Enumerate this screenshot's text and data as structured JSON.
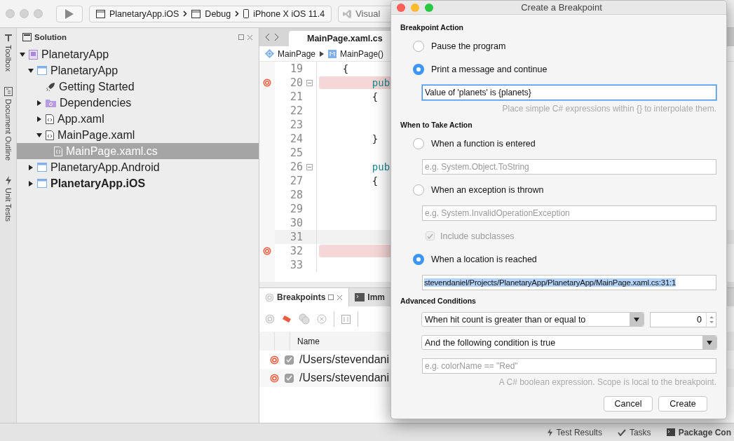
{
  "toolbar": {
    "scheme": [
      "PlanetaryApp.iOS",
      "Debug",
      "iPhone X iOS 11.4"
    ],
    "status": "Visual"
  },
  "side_tabs": [
    {
      "label": "Toolbox",
      "kind": "toolbox"
    },
    {
      "label": "Document Outline",
      "kind": "outline"
    },
    {
      "label": "Unit Tests",
      "kind": "tests"
    }
  ],
  "solution": {
    "title": "Solution",
    "tree": [
      {
        "label": "PlanetaryApp",
        "kind": "solution",
        "expanded": true,
        "selected": false,
        "startup": false,
        "children": [
          {
            "label": "PlanetaryApp",
            "kind": "project",
            "expanded": true,
            "selected": false,
            "startup": false,
            "children": [
              {
                "label": "Getting Started",
                "kind": "rocket",
                "selected": false,
                "startup": false
              },
              {
                "label": "Dependencies",
                "kind": "folder",
                "expanded": false,
                "selected": false,
                "startup": false
              },
              {
                "label": "App.xaml",
                "kind": "xaml",
                "expanded": false,
                "selected": false,
                "startup": false
              },
              {
                "label": "MainPage.xaml",
                "kind": "xaml",
                "expanded": true,
                "selected": false,
                "startup": false,
                "children": [
                  {
                    "label": "MainPage.xaml.cs",
                    "kind": "cs",
                    "selected": true,
                    "startup": false
                  }
                ]
              }
            ]
          },
          {
            "label": "PlanetaryApp.Android",
            "kind": "project",
            "expanded": false,
            "selected": false,
            "startup": false
          },
          {
            "label": "PlanetaryApp.iOS",
            "kind": "project",
            "expanded": false,
            "selected": false,
            "startup": true
          }
        ]
      }
    ]
  },
  "editor": {
    "tab": "MainPage.xaml.cs",
    "breadcrumb": [
      "MainPage",
      "MainPage()"
    ],
    "lines": [
      {
        "number": "19",
        "code": "    {",
        "kind": "punct",
        "breakpoint": false,
        "fold": false,
        "current": false
      },
      {
        "number": "20",
        "code": "         pub",
        "kind": "keyword",
        "breakpoint": true,
        "fold": true,
        "current": false
      },
      {
        "number": "21",
        "code": "         {",
        "kind": "punct",
        "breakpoint": false,
        "fold": false,
        "current": false
      },
      {
        "number": "22",
        "breakpoint": false,
        "fold": false,
        "current": false
      },
      {
        "number": "23",
        "breakpoint": false,
        "fold": false,
        "current": false
      },
      {
        "number": "24",
        "code": "         }",
        "kind": "punct",
        "breakpoint": false,
        "fold": false,
        "current": false
      },
      {
        "number": "25",
        "breakpoint": false,
        "fold": false,
        "current": false
      },
      {
        "number": "26",
        "code": "         pub",
        "kind": "keyword",
        "breakpoint": false,
        "fold": true,
        "current": false
      },
      {
        "number": "27",
        "code": "         {",
        "kind": "punct",
        "breakpoint": false,
        "fold": false,
        "current": false
      },
      {
        "number": "28",
        "breakpoint": false,
        "fold": false,
        "current": false
      },
      {
        "number": "29",
        "breakpoint": false,
        "fold": false,
        "current": false
      },
      {
        "number": "30",
        "breakpoint": false,
        "fold": false,
        "current": false
      },
      {
        "number": "31",
        "breakpoint": false,
        "fold": false,
        "current": true
      },
      {
        "number": "32",
        "breakpoint": true,
        "fold": false,
        "current": false
      },
      {
        "number": "33",
        "breakpoint": false,
        "fold": false,
        "current": false
      }
    ]
  },
  "bottom_panel": {
    "tabs": [
      {
        "label": "Breakpoints",
        "selected": true
      },
      {
        "label": "Imm",
        "selected": false
      }
    ],
    "column": "Name",
    "rows": [
      {
        "checked": true,
        "name": "/Users/stevendani"
      },
      {
        "checked": true,
        "name": "/Users/stevendani"
      }
    ]
  },
  "status_bar": [
    {
      "label": "Test Results",
      "kind": "bolt"
    },
    {
      "label": "Tasks",
      "kind": "check"
    },
    {
      "label": "Package Con",
      "kind": "console"
    }
  ],
  "dialog": {
    "title": "Create a Breakpoint",
    "sections": [
      {
        "heading": "Breakpoint Action",
        "items": [
          {
            "kind": "radio",
            "label": "Pause the program",
            "selected": false
          },
          {
            "kind": "radio",
            "label": "Print a message and continue",
            "selected": true
          },
          {
            "kind": "field",
            "value": "Value of 'planets' is {planets}",
            "focused": true
          },
          {
            "kind": "hint",
            "text": "Place simple C# expressions within {} to interpolate them."
          }
        ]
      },
      {
        "heading": "When to Take Action",
        "items": [
          {
            "kind": "radio",
            "label": "When a function is entered",
            "selected": false
          },
          {
            "kind": "field",
            "placeholder": "e.g. System.Object.ToString",
            "focused": false
          },
          {
            "kind": "radio",
            "label": "When an exception is thrown",
            "selected": false
          },
          {
            "kind": "field",
            "placeholder": "e.g. System.InvalidOperationException",
            "focused": false
          },
          {
            "kind": "checkbox",
            "label": "Include subclasses",
            "checked": true,
            "disabled": true
          },
          {
            "kind": "radio",
            "label": "When a location is reached",
            "selected": true
          },
          {
            "kind": "location",
            "value": "stevendaniel/Projects/PlanetaryApp/PlanetaryApp/MainPage.xaml.cs:31:1",
            "highlighted": true
          }
        ]
      },
      {
        "heading": "Advanced Conditions",
        "items": [
          {
            "kind": "hitcount",
            "value": "When hit count is greater than or equal to",
            "count": "0"
          },
          {
            "kind": "select",
            "value": "And the following condition is true"
          },
          {
            "kind": "field",
            "placeholder": "e.g. colorName == \"Red\"",
            "focused": false
          },
          {
            "kind": "hint",
            "text": "A C# boolean expression. Scope is local to the breakpoint."
          }
        ]
      }
    ],
    "buttons": [
      "Cancel",
      "Create"
    ]
  }
}
